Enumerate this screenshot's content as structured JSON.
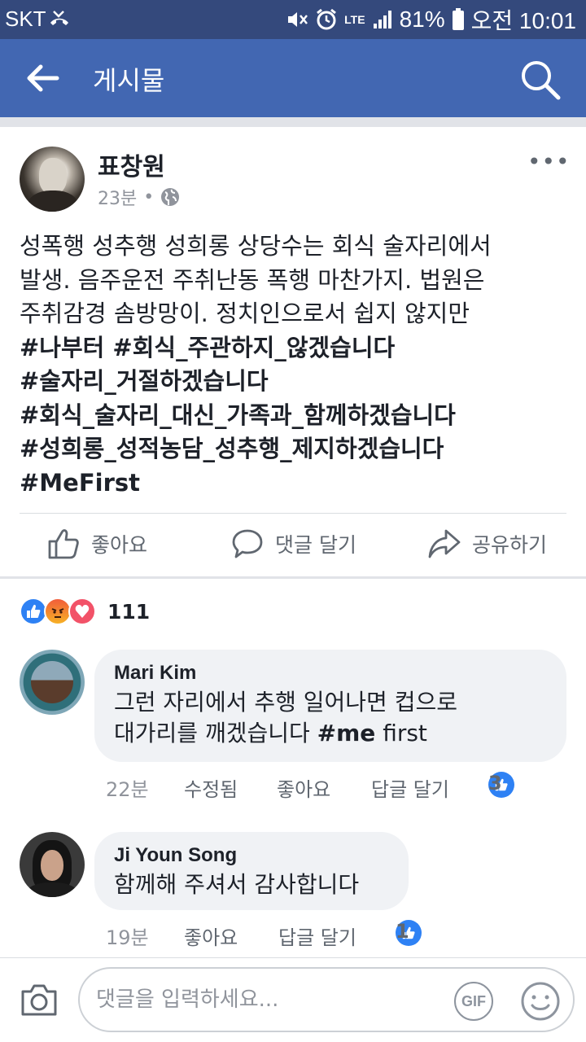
{
  "status_bar": {
    "carrier": "SKT",
    "battery": "81%",
    "time": "오전 10:01",
    "network": "LTE"
  },
  "app_bar": {
    "title": "게시물",
    "back_icon": "arrow-left-icon",
    "search_icon": "search-icon"
  },
  "post": {
    "author": "표창원",
    "time": "23분",
    "dot": "•",
    "privacy_icon": "globe-icon",
    "body_lines": [
      "성폭행 성추행 성희롱 상당수는 회식 술자리에서",
      "발생. 음주운전 주취난동 폭행 마찬가지. 법원은",
      "주취감경 솜방망이. 정치인으로서 쉽지 않지만"
    ],
    "hashtags": [
      "#나부터 #회식_주관하지_않겠습니다",
      "#술자리_거절하겠습니다",
      "#회식_술자리_대신_가족과_함께하겠습니다",
      "#성희롱_성적농담_성추행_제지하겠습니다",
      "#MeFirst"
    ],
    "more_label": "•••"
  },
  "actions": {
    "like": "좋아요",
    "comment": "댓글 달기",
    "share": "공유하기"
  },
  "reactions": {
    "count": "111",
    "types": [
      "like",
      "angry",
      "love"
    ]
  },
  "comments": [
    {
      "name": "Mari Kim",
      "line1": "그런 자리에서 추행 일어나면 컵으로",
      "line2_prefix": "대가리를  깨겠습니다 ",
      "line2_bold": "#me",
      "line2_suffix": " first",
      "time": "22분",
      "edited": "수정됨",
      "like": "좋아요",
      "reply": "답글 달기",
      "like_count": "3"
    },
    {
      "name": "Ji Youn Song",
      "line1": "함께해 주셔서 감사합니다",
      "time": "19분",
      "like": "좋아요",
      "reply": "답글 달기",
      "like_count": "1"
    }
  ],
  "composer": {
    "placeholder": "댓글을 입력하세요...",
    "gif_label": "GIF"
  },
  "colors": {
    "status_bar": "#34497c",
    "app_bar": "#4267b2",
    "like_blue": "#2e81f4",
    "bubble": "#f0f2f5"
  }
}
